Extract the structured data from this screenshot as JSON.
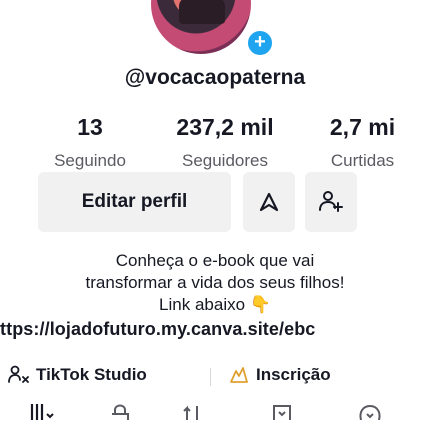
{
  "profile": {
    "username": "@vocacaopaterna"
  },
  "stats": [
    {
      "value": "13",
      "label": "Seguindo"
    },
    {
      "value": "237,2 mil",
      "label": "Seguidores"
    },
    {
      "value": "2,7 mi",
      "label": "Curtidas"
    }
  ],
  "actions": {
    "edit_label": "Editar perfil"
  },
  "bio": {
    "line1": "Conheça o e-book que vai",
    "line2": "transformar a vida dos seus filhos!",
    "line3": "Link abaixo 👇"
  },
  "link": {
    "text": "ttps://lojadofuturo.my.canva.site/ebc"
  },
  "tools": [
    {
      "label": "TikTok Studio",
      "icon": "studio-icon"
    },
    {
      "label": "Inscrição",
      "icon": "subscription-icon"
    }
  ],
  "colors": {
    "accent_badge": "#1fa5f0",
    "button_bg": "#f1f1f2",
    "text_primary": "#161823",
    "text_secondary": "#5a5b62"
  }
}
